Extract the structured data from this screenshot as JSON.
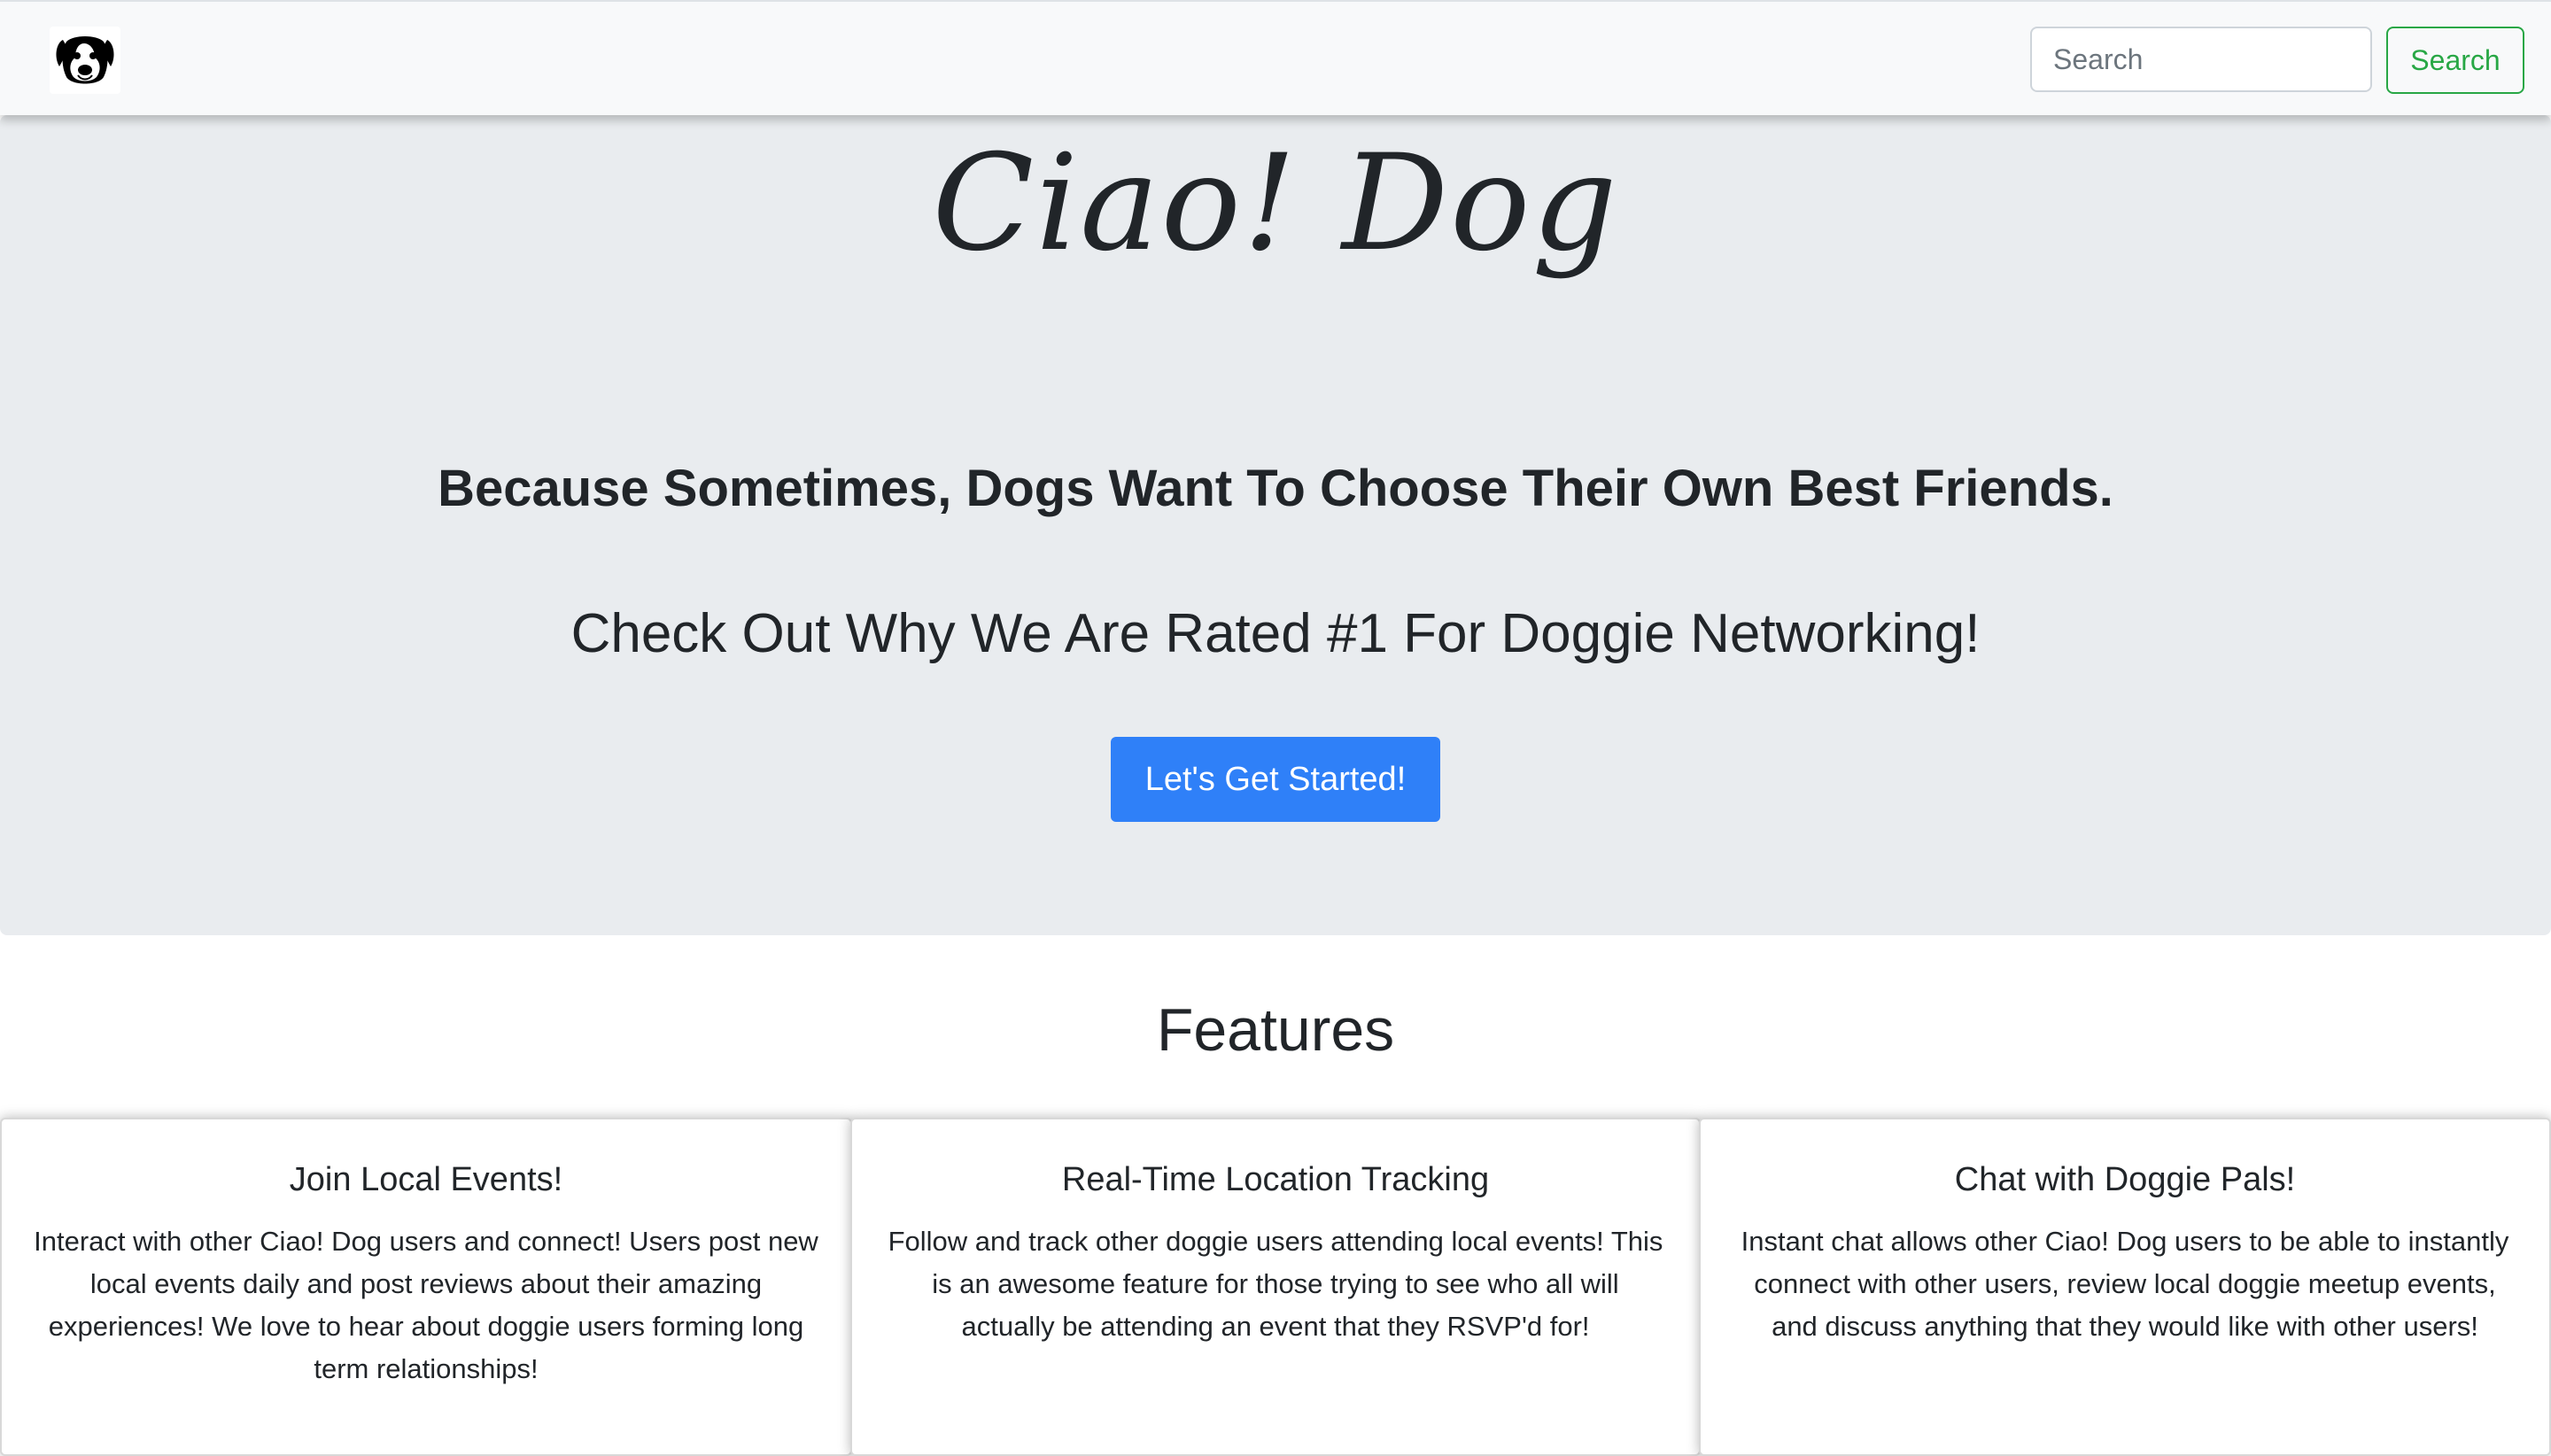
{
  "navbar": {
    "logo_icon": "dog-face-icon",
    "search_placeholder": "Search",
    "search_button_label": "Search",
    "search_button_color": "#28a745"
  },
  "hero": {
    "title": "Ciao! Dog",
    "tagline": "Because Sometimes, Dogs Want To Choose Their Own Best Friends.",
    "subtagline": "Check Out Why We Are Rated #1 For Doggie Networking!",
    "cta_label": "Let's Get Started!",
    "cta_color": "#2f80f8",
    "background_color": "#e9ecef"
  },
  "features": {
    "heading": "Features",
    "cards": [
      {
        "title": "Join Local Events!",
        "text": "Interact with other Ciao! Dog users and connect! Users post new local events daily and post reviews about their amazing experiences! We love to hear about doggie users forming long term relationships!"
      },
      {
        "title": "Real-Time Location Tracking",
        "text": "Follow and track other doggie users attending local events! This is an awesome feature for those trying to see who all will actually be attending an event that they RSVP'd for!"
      },
      {
        "title": "Chat with Doggie Pals!",
        "text": "Instant chat allows other Ciao! Dog users to be able to instantly connect with other users, review local doggie meetup events, and discuss anything that they would like with other users!"
      }
    ]
  }
}
